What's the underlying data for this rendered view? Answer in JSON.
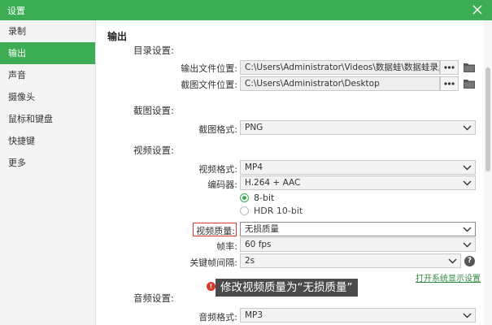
{
  "window": {
    "title": "设置"
  },
  "sidebar": {
    "items": [
      {
        "label": "录制"
      },
      {
        "label": "输出"
      },
      {
        "label": "声音"
      },
      {
        "label": "摄像头"
      },
      {
        "label": "鼠标和键盘"
      },
      {
        "label": "快捷键"
      },
      {
        "label": "更多"
      }
    ],
    "active_index": 1
  },
  "main": {
    "heading": "输出",
    "directory": {
      "section_label": "目录设置:",
      "output_label": "输出文件位置:",
      "output_path": "C:\\Users\\Administrator\\Videos\\数据蛙\\数据蛙录屏软件",
      "screenshot_label": "截图文件位置:",
      "screenshot_path": "C:\\Users\\Administrator\\Desktop",
      "browse_glyph": "•••"
    },
    "screenshot": {
      "section_label": "截图设置:",
      "format_label": "截图格式:",
      "format_value": "PNG"
    },
    "video": {
      "section_label": "视频设置:",
      "format_label": "视频格式:",
      "format_value": "MP4",
      "encoder_label": "编码器:",
      "encoder_value": "H.264 + AAC",
      "bit_options": [
        {
          "label": "8-bit",
          "selected": true
        },
        {
          "label": "HDR 10-bit",
          "selected": false
        }
      ],
      "quality_label": "视频质量:",
      "quality_value": "无损质量",
      "fps_label": "帧率:",
      "fps_value": "60 fps",
      "keyframe_label": "关键帧间隔:",
      "keyframe_value": "2s",
      "help_glyph": "?",
      "system_display_link": "打开系统显示设置"
    },
    "audio": {
      "section_label": "音频设置:",
      "format_label": "音频格式:",
      "format_value": "MP3"
    }
  },
  "annotation": {
    "icon_glyph": "!",
    "text": "修改视频质量为“无损质量”"
  },
  "colors": {
    "accent": "#3cac55",
    "highlight_border": "#e0352b",
    "tooltip_bg": "#4a4a4a"
  }
}
